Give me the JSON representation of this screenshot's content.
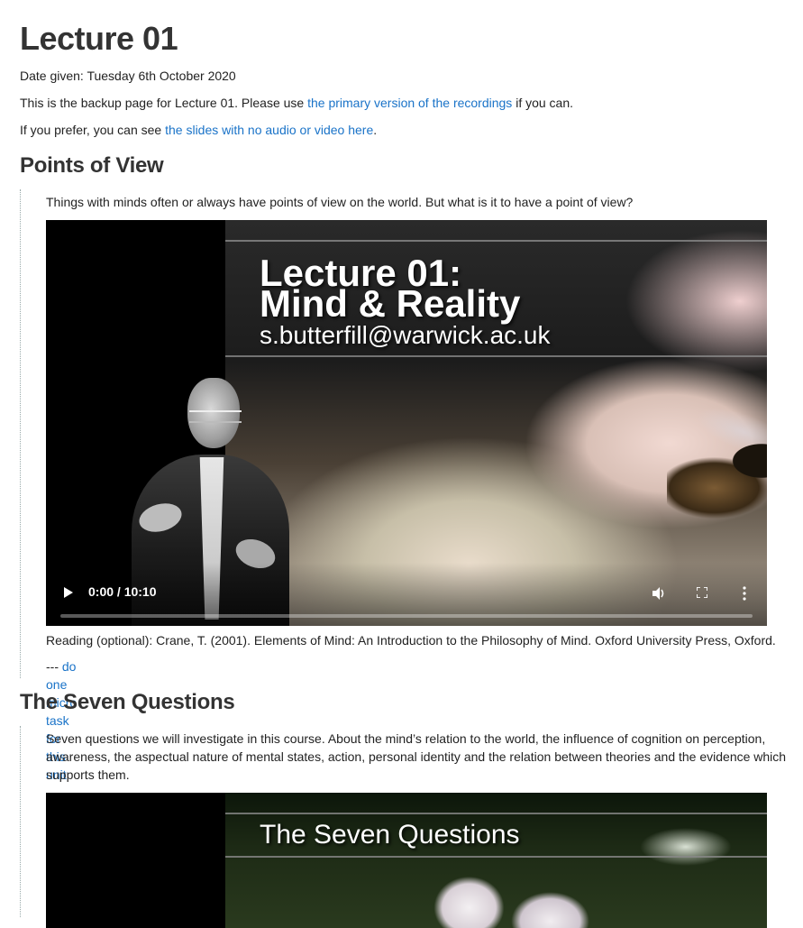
{
  "page": {
    "title": "Lecture 01",
    "date_given": "Date given: Tuesday 6th October 2020",
    "backup_text_before": "This is the backup page for Lecture 01. Please use ",
    "backup_link": "the primary version of the recordings",
    "backup_text_after": " if you can.",
    "slides_text_before": "If you prefer, you can see ",
    "slides_link": "the slides with no audio or video here",
    "slides_text_after": "."
  },
  "units": [
    {
      "heading": "Points of View",
      "description": "Things with minds often or always have points of view on the world. But what is it to have a point of view?",
      "video": {
        "slide_title_line1": "Lecture 01:",
        "slide_title_line2": "Mind & Reality",
        "slide_email": "s.butterfill@warwick.ac.uk",
        "time": "0:00 / 10:10",
        "progress": 0
      },
      "reading": "Reading (optional): Crane, T. (2001). Elements of Mind: An Introduction to the Philosophy of Mind. Oxford University Press, Oxford.",
      "micro_prefix": "--- ",
      "micro_link": "do one micro task for this unit"
    },
    {
      "heading": "The Seven Questions",
      "description": "Seven questions we will investigate in this course. About the mind’s relation to the world, the influence of cognition on perception, awareness, the aspectual nature of mental states, action, personal identity and the relation between theories and the evidence which supports them.",
      "video": {
        "slide_title": "The Seven Questions"
      }
    }
  ],
  "colors": {
    "link": "#1a73c8",
    "heading": "#333333",
    "text": "#222222"
  }
}
